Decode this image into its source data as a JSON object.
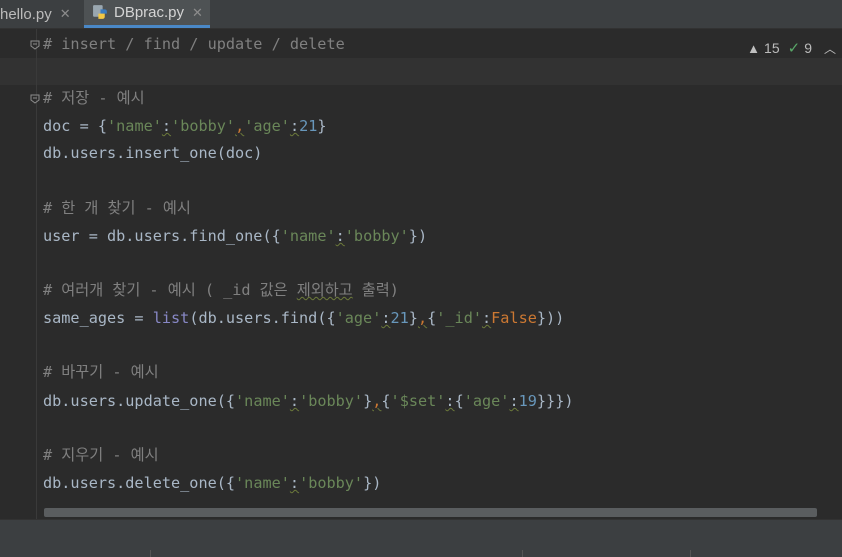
{
  "tabs": [
    {
      "label": "hello.py",
      "active": false
    },
    {
      "label": "DBprac.py",
      "active": true
    }
  ],
  "inspection": {
    "warnings": "15",
    "weak_warnings": "9"
  },
  "code": {
    "l1": "# insert / find / update / delete",
    "l3": "# 저장 - 예시",
    "l4": {
      "a": "doc = {",
      "b": "'name'",
      "c": ":",
      "d": "'bobby'",
      "e": ",",
      "f": "'age'",
      "g": ":",
      "h": "21",
      "i": "}"
    },
    "l5": "db.users.insert_one(doc)",
    "l7": "# 한 개 찾기 - 예시",
    "l8": {
      "a": "user = db.users.find_one({",
      "b": "'name'",
      "c": ":",
      "d": "'bobby'",
      "e": "})"
    },
    "l10": {
      "a": "# 여러개 찾기 - 예시 ( _id 값은 ",
      "b": "제외하고",
      "c": " 출력)"
    },
    "l11": {
      "a": "same_ages = ",
      "b": "list",
      "c": "(db.users.find({",
      "d": "'age'",
      "e": ":",
      "f": "21",
      "g": "}",
      "h": ",",
      "i": "{",
      "j": "'_id'",
      "k": ":",
      "l": "False",
      "m": "}))"
    },
    "l13": "# 바꾸기 - 예시",
    "l14": {
      "a": "db.users.update_one({",
      "b": "'name'",
      "c": ":",
      "d": "'bobby'",
      "e": "}",
      "f": ",",
      "g": "{",
      "h": "'$set'",
      "i": ":",
      "j": "{",
      "k": "'age'",
      "l": ":",
      "m": "19",
      "n": "}}})"
    },
    "l16": "# 지우기 - 예시",
    "l17": {
      "a": "db.users.delete_one({",
      "b": "'name'",
      "c": ":",
      "d": "'bobby'",
      "e": "})"
    }
  },
  "colors": {
    "background": "#2b2b2b",
    "comment": "#808080",
    "string": "#6a8759",
    "number": "#6897bb",
    "keyword": "#cc7832",
    "builtin": "#8888c6"
  }
}
